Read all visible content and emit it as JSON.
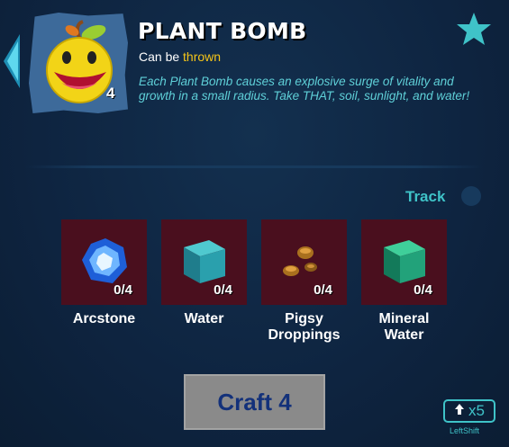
{
  "item": {
    "name": "PLANT BOMB",
    "subtitle_prefix": "Can be",
    "subtitle_highlight": "thrown",
    "count": "4",
    "description": "Each Plant Bomb causes an explosive surge of vitality and growth in a small radius. Take THAT, soil, sunlight, and water!"
  },
  "track": {
    "label": "Track"
  },
  "ingredients": [
    {
      "name": "Arcstone",
      "qty": "0/4",
      "icon": "arcstone-icon"
    },
    {
      "name": "Water",
      "qty": "0/4",
      "icon": "water-cube-icon"
    },
    {
      "name": "Pigsy\nDroppings",
      "qty": "0/4",
      "icon": "droppings-icon"
    },
    {
      "name": "Mineral\nWater",
      "qty": "0/4",
      "icon": "mineral-water-cube-icon"
    }
  ],
  "craft": {
    "label": "Craft 4"
  },
  "shortcut": {
    "multiplier": "x5",
    "key_label": "LeftShift"
  },
  "colors": {
    "accent": "#3fc3c8",
    "highlight": "#f5c518",
    "background": "#0e2440",
    "ingredient_bg": "#4a0f1e"
  }
}
